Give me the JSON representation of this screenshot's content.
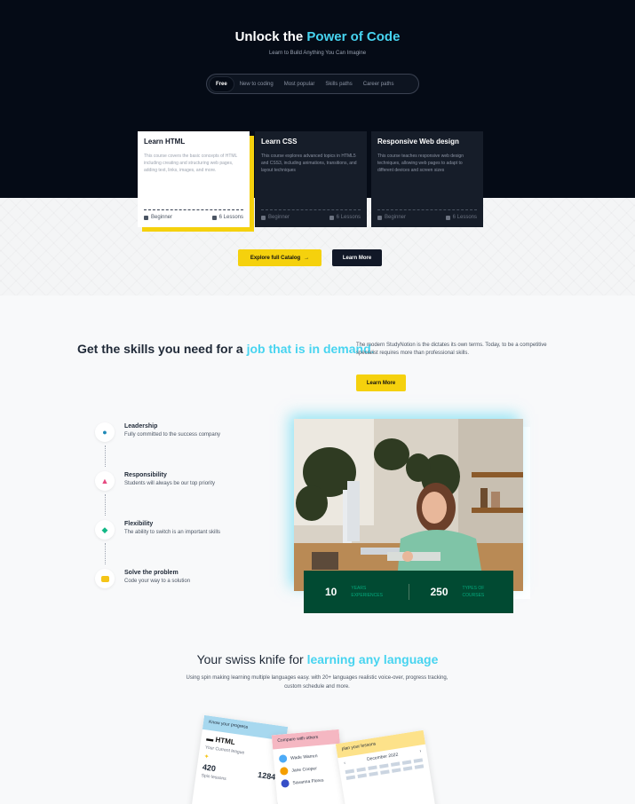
{
  "hero": {
    "title_part1": "Unlock the ",
    "title_accent": "Power of Code",
    "subtitle": "Learn to Build Anything You Can Imagine",
    "tabs": [
      "Free",
      "New to coding",
      "Most popular",
      "Skills paths",
      "Career paths"
    ],
    "active_tab": "Free"
  },
  "courses": [
    {
      "title": "Learn HTML",
      "description": "This course covers the basic concepts of HTML including creating and structuring web pages, adding text, links, images, and more.",
      "level": "Beginner",
      "lessons": "6 Lessons"
    },
    {
      "title": "Learn CSS",
      "description": "This course explores advanced topics in HTML5 and CSS3, including animations, transitions, and layout techniques",
      "level": "Beginner",
      "lessons": "6 Lessons"
    },
    {
      "title": "Responsive Web design",
      "description": "This course teaches responsive web design techniques, allowing web pages to adapt to different devices and screen sizes",
      "level": "Beginner",
      "lessons": "6 Lessons"
    }
  ],
  "catalog_buttons": {
    "explore": "Explore full Catalog",
    "learn_more": "Learn More"
  },
  "skills": {
    "title_part1": "Get the skills you need for a ",
    "title_accent": "job that is in demand.",
    "description": "The modern StudyNotion is the dictates its own terms. Today, to be a competitive specialist requires more than professional skills.",
    "button": "Learn More"
  },
  "features": [
    {
      "title": "Leadership",
      "desc": "Fully committed to the success company",
      "icon": "medal-icon"
    },
    {
      "title": "Responsibility",
      "desc": "Students will always be our top priority",
      "icon": "graduation-cap-icon"
    },
    {
      "title": "Flexibility",
      "desc": "The ability to switch is an important skills",
      "icon": "diamond-icon"
    },
    {
      "title": "Solve the problem",
      "desc": "Code your way to a solution",
      "icon": "code-icon"
    }
  ],
  "stats": [
    {
      "value": "10",
      "label_1": "YEARS",
      "label_2": "EXPERIENCES"
    },
    {
      "value": "250",
      "label_1": "TYPES OF",
      "label_2": "COURSES"
    }
  ],
  "knife": {
    "title_part1": "Your swiss knife for ",
    "title_accent": "learning any language",
    "description": "Using spin making learning multiple languages easy. with 20+ languages realistic voice-over, progress tracking, custom schedule and more."
  },
  "preview_cards": {
    "progress_head": "Know your progress",
    "progress_title": "HTML",
    "progress_sub": "Your Current league",
    "progress_num1": "420",
    "progress_num2": "1284",
    "progress_foot": "Spin lessons",
    "compare_head": "Compare with others",
    "people": [
      "Wade Warren",
      "Jane Cooper",
      "Savanna Flores"
    ],
    "plan_head": "plan your lessons",
    "month": "December 2022"
  },
  "colors": {
    "accent": "#47d4f0",
    "yellow": "#f5d10d",
    "dark": "#050b16",
    "green": "#014a32"
  }
}
